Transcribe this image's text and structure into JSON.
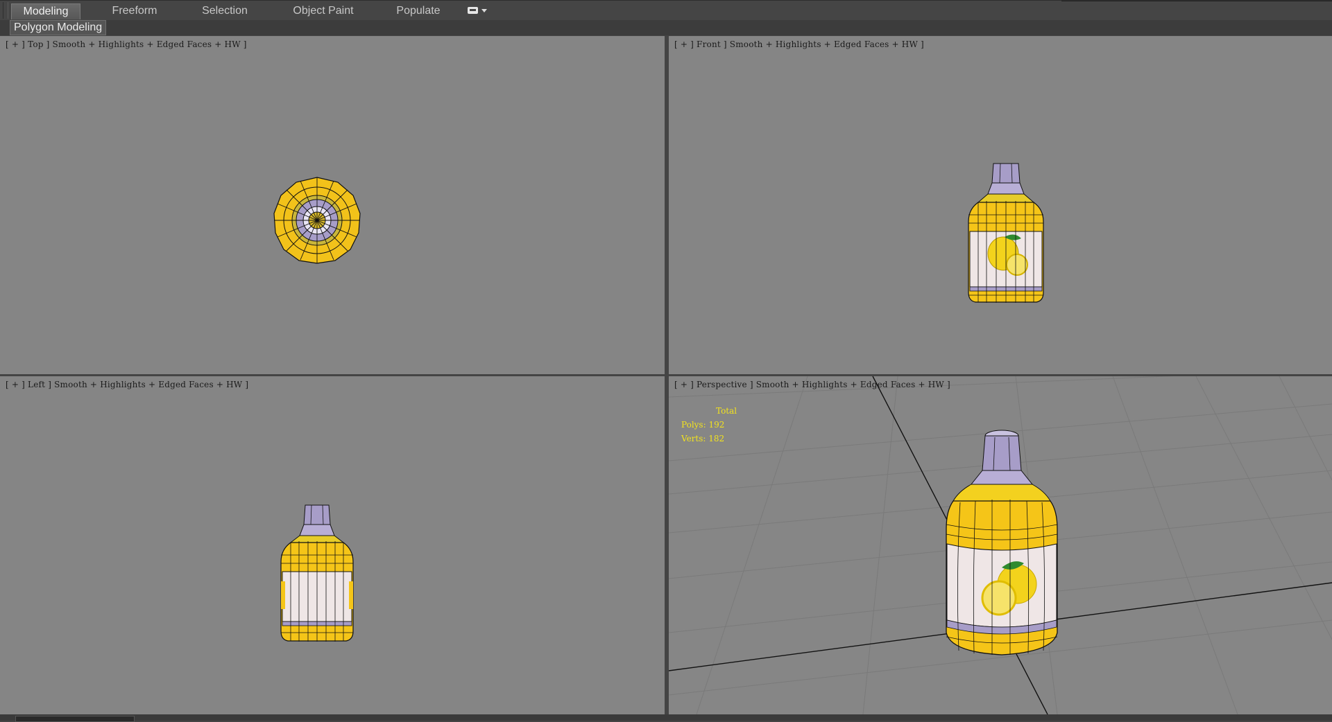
{
  "ribbon": {
    "tabs": [
      {
        "label": "Modeling",
        "active": true
      },
      {
        "label": "Freeform",
        "active": false
      },
      {
        "label": "Selection",
        "active": false
      },
      {
        "label": "Object Paint",
        "active": false
      },
      {
        "label": "Populate",
        "active": false
      }
    ],
    "extra_icon": "ribbon-options-icon",
    "sub_label": "Polygon Modeling"
  },
  "viewports": {
    "top": {
      "label": "[ + ] Top ] Smooth + Highlights + Edged Faces + HW ]"
    },
    "front": {
      "label": "[ + ] Front ] Smooth + Highlights + Edged Faces + HW ]"
    },
    "left": {
      "label": "[ + ] Left ] Smooth + Highlights + Edged Faces + HW ]"
    },
    "perspective": {
      "label": "[ + ] Perspective ] Smooth + Highlights + Edged Faces + HW ]",
      "stats": {
        "total": "Total",
        "polys": "Polys: 192",
        "verts": "Verts: 182"
      }
    }
  },
  "colors": {
    "viewport_bg": "#858585",
    "bottle_yellow": "#f5c518",
    "cap_purple": "#a79dc8",
    "label_white": "#efe6e6",
    "stats_yellow": "#f2e21e"
  }
}
